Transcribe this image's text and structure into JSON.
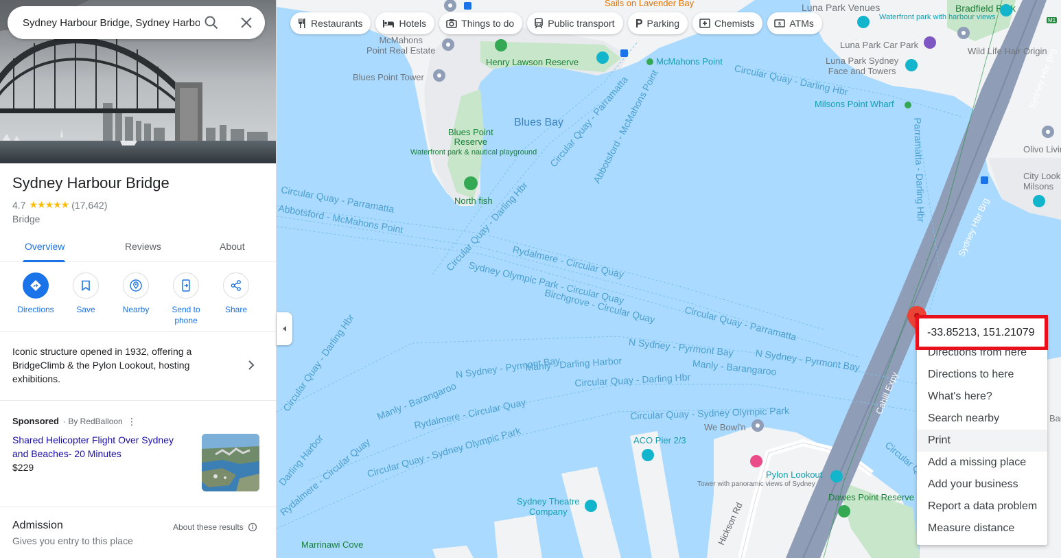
{
  "search": {
    "value": "Sydney Harbour Bridge, Sydney Harbour",
    "search_icon": "search-icon",
    "close_icon": "close-icon"
  },
  "place": {
    "name": "Sydney Harbour Bridge",
    "rating": "4.7",
    "stars": "★★★★★",
    "reviews_count": "(17,642)",
    "category": "Bridge"
  },
  "tabs": [
    {
      "label": "Overview"
    },
    {
      "label": "Reviews"
    },
    {
      "label": "About"
    }
  ],
  "actions": [
    {
      "label": "Directions",
      "icon": "directions-icon"
    },
    {
      "label": "Save",
      "icon": "bookmark-icon"
    },
    {
      "label": "Nearby",
      "icon": "nearby-icon"
    },
    {
      "label": "Send to phone",
      "icon": "send-to-phone-icon"
    },
    {
      "label": "Share",
      "icon": "share-icon"
    }
  ],
  "description": "Iconic structure opened in 1932, offering a BridgeClimb & the Pylon Lookout, hosting exhibitions.",
  "sponsored": {
    "label": "Sponsored",
    "byline": "· By RedBalloon",
    "title": "Shared Helicopter Flight Over Sydney and Beaches- 20 Minutes",
    "price": "$229"
  },
  "admission": {
    "title": "Admission",
    "subtitle": "Gives you entry to this place",
    "about": "About these results"
  },
  "chips": [
    {
      "label": "Restaurants",
      "icon": "restaurant-icon"
    },
    {
      "label": "Hotels",
      "icon": "hotel-icon"
    },
    {
      "label": "Things to do",
      "icon": "camera-icon"
    },
    {
      "label": "Public transport",
      "icon": "train-icon"
    },
    {
      "label": "Parking",
      "icon": "parking-icon"
    },
    {
      "label": "Chemists",
      "icon": "pharmacy-icon"
    },
    {
      "label": "ATMs",
      "icon": "atm-icon"
    }
  ],
  "map_labels": {
    "sails": "Sails on Lavender Bay",
    "luna_venues": "Luna Park Venues",
    "luna_venues_sub": "Waterfront park with harbour views",
    "bradfield": "Bradfield Park",
    "mcmahons_real_estate": "McMahons\nPoint Real Estate",
    "henry_lawson": "Henry Lawson Reserve",
    "mcmahons_point": "McMahons Point",
    "luna_car_park": "Luna Park Car Park",
    "wild_hair": "Wild Life Hair Origin",
    "luna_park_sydney": "Luna Park Sydney\nFace and Towers",
    "blues_tower": "Blues Point Tower",
    "milsons_wharf": "Milsons Point Wharf",
    "blues_bay": "Blues Bay",
    "blues_reserve": "Blues Point\nReserve",
    "blues_reserve_sub": "Waterfront park & nautical playground",
    "olivo": "Olivo Living Seawa",
    "city_look": "City Look\nMilsons",
    "north_fish": "North fish",
    "we_bowl": "We Bowl'n",
    "aco_pier": "ACO Pier 2/3",
    "pylon": "Pylon Lookout",
    "pylon_sub": "Tower with panoramic views of Sydney",
    "dawes": "Dawes Point Reserve",
    "sydney_theatre": "Sydney Theatre\nCompany",
    "marrinawi": "Marrinawi Cove",
    "hickson": "Hickson Rd",
    "cahill": "Cahill Expy",
    "sydney_hbr_brg": "Sydney Hbr Brg",
    "m1": "M1",
    "ferry": [
      "Circular Quay - Darling Hbr",
      "Circular Quay - Parramatta",
      "Abbotsford - McMahons Point",
      "Circular Quay - Parramatta",
      "Abbotsford - McMahons Point",
      "Circular Quay - Darling Hbr",
      "Rydalmere - Circular Quay",
      "Sydney Olympic Park - Circular Quay",
      "Birchgrove - Circular Quay",
      "Circular Quay - Parramatta",
      "N Sydney - Pyrmont Bay",
      "N Sydney - Pyrmont Bay",
      "N Sydney - Pyrmont Bay",
      "Manly - Darling Harbor",
      "Manly - Barangaroo",
      "Circular Quay - Darling Hbr",
      "Manly - Barangaroo",
      "Rydalmere - Circular Quay",
      "Circular Quay - Sydney Olympic Park",
      "Circular Quay - Sydney Olympic Park",
      "Rydalmere - Circular Quay",
      "Circular Quay - Darling Hbr",
      "Parramatta - Darling Hbr",
      "Circular Quay",
      "Darling Harbor",
      "Bar"
    ]
  },
  "context_menu": {
    "coords": "-33.85213, 151.21079",
    "items": [
      "Directions from here",
      "Directions to here",
      "What's here?",
      "Search nearby",
      "Print",
      "Add a missing place",
      "Add your business",
      "Report a data problem",
      "Measure distance"
    ]
  },
  "colors": {
    "water": "#aadaff",
    "land": "#f1f3f4",
    "park": "#c8e6c9",
    "road": "#8f9db6",
    "accent": "#1a73e8",
    "highlight": "#e8101b"
  }
}
